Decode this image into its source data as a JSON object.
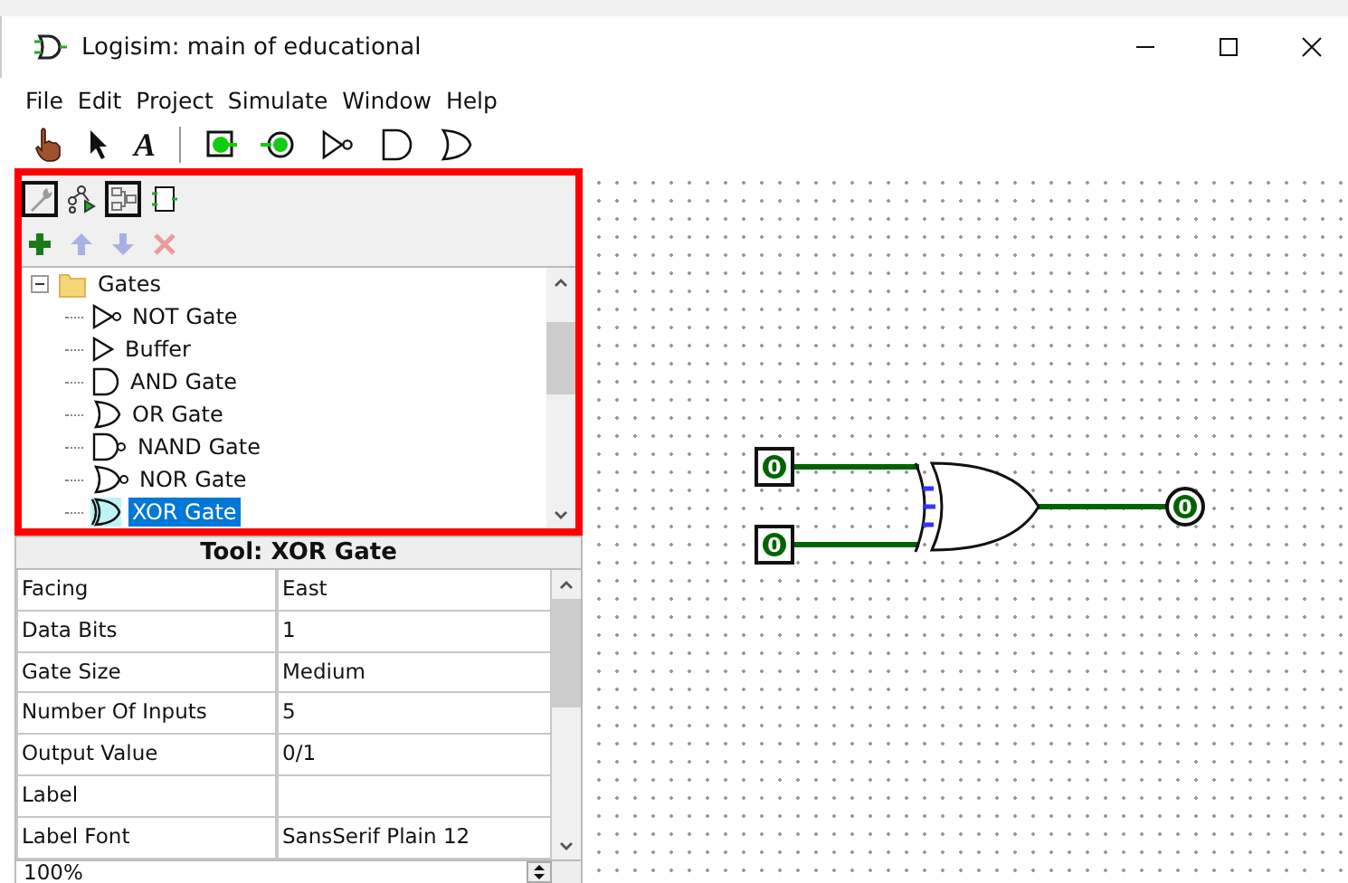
{
  "window": {
    "title": "Logisim: main of educational"
  },
  "menu": [
    "File",
    "Edit",
    "Project",
    "Simulate",
    "Window",
    "Help"
  ],
  "toolbar": [
    {
      "kind": "poke"
    },
    {
      "kind": "select"
    },
    {
      "kind": "text",
      "label": "A"
    },
    {
      "kind": "sep"
    },
    {
      "kind": "input"
    },
    {
      "kind": "output"
    },
    {
      "kind": "not"
    },
    {
      "kind": "and"
    },
    {
      "kind": "or"
    }
  ],
  "explorer_tools": [
    {
      "kind": "wrench",
      "selected": true
    },
    {
      "kind": "tree",
      "selected": false
    },
    {
      "kind": "layout",
      "selected": true
    },
    {
      "kind": "appearance",
      "selected": false
    }
  ],
  "edit_tools": [
    {
      "kind": "add",
      "disabled": false
    },
    {
      "kind": "up",
      "disabled": true
    },
    {
      "kind": "down",
      "disabled": true
    },
    {
      "kind": "remove",
      "disabled": true
    }
  ],
  "tree": {
    "label": "Gates",
    "expanded": true,
    "children": [
      {
        "label": "NOT Gate",
        "kind": "not",
        "selected": false
      },
      {
        "label": "Buffer",
        "kind": "buffer",
        "selected": false
      },
      {
        "label": "AND Gate",
        "kind": "and",
        "selected": false
      },
      {
        "label": "OR Gate",
        "kind": "or",
        "selected": false
      },
      {
        "label": "NAND Gate",
        "kind": "nand",
        "selected": false
      },
      {
        "label": "NOR Gate",
        "kind": "nor",
        "selected": false
      },
      {
        "label": "XOR Gate",
        "kind": "xor",
        "selected": true
      }
    ]
  },
  "properties": {
    "title": "Tool: XOR Gate",
    "rows": [
      {
        "name": "Facing",
        "value": "East"
      },
      {
        "name": "Data Bits",
        "value": "1"
      },
      {
        "name": "Gate Size",
        "value": "Medium"
      },
      {
        "name": "Number Of Inputs",
        "value": "5"
      },
      {
        "name": "Output Value",
        "value": "0/1"
      },
      {
        "name": "Label",
        "value": ""
      },
      {
        "name": "Label Font",
        "value": "SansSerif Plain 12"
      }
    ]
  },
  "zoom": "100%",
  "circuit": {
    "inputs": [
      "0",
      "0"
    ],
    "output": "0"
  }
}
